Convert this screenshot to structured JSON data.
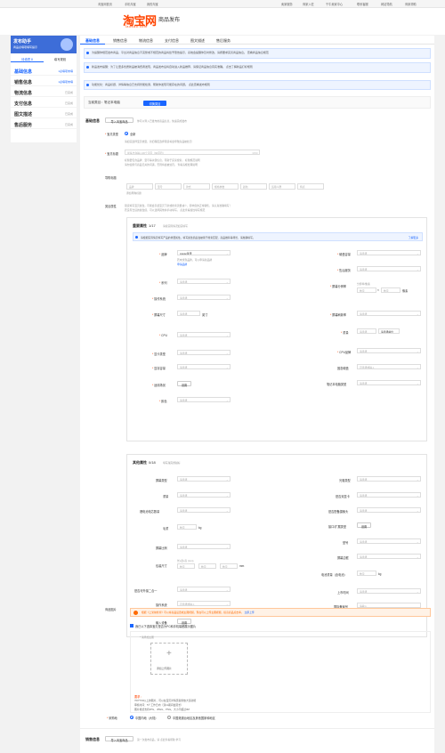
{
  "topbar": {
    "left": [
      "淘宝网首页",
      "手机淘宝",
      "我的淘宝"
    ],
    "right": [
      "卖家服务",
      "商家入驻",
      "千牛卖家中心",
      "联系客服",
      "网站导航",
      "商家帮助"
    ]
  },
  "header": {
    "logo": "淘宝网",
    "logo_sub": "Taobao.com",
    "title": "商品发布"
  },
  "sidebar": {
    "hero_title": "发布助手",
    "hero_sub": "商品必填项填写提示",
    "tabs": [
      "待填项 8",
      "填写规则"
    ],
    "items": [
      {
        "label": "基础信息",
        "status": "1必填项未填"
      },
      {
        "label": "销售信息",
        "status": "1必填项未填"
      },
      {
        "label": "物流信息",
        "status": "已完成"
      },
      {
        "label": "支付信息",
        "status": "已完成"
      },
      {
        "label": "图文描述",
        "status": "已完成"
      },
      {
        "label": "售后服务",
        "status": "已完成"
      }
    ]
  },
  "tabs": [
    "基础信息",
    "销售信息",
    "物流信息",
    "支付信息",
    "图文描述",
    "售后服务"
  ],
  "notices": [
    "为提醒你规范发布商品，平台对商品信息不完整或不规范的商品将给予警告提示，系统会提醒你及时修改，请按要求完善商品信息。 查看商品信息规范",
    "新品发布提醒：为了让更多优质新品被消费者发现，商品发布后将自动进入新品推荐，请保证商品信息真实准确。 点击了解新品打标规则",
    "功能优化：商品标题、详情等信息已支持智能检测，帮助你发现可能存在的问题。 点此查看发布规则"
  ],
  "category": {
    "label": "当前类目：笔记本电脑",
    "button": "切换类目"
  },
  "basic": {
    "section": "基础信息",
    "import_btn": "导入淘宝商品",
    "import_hint": "你可以导入已发布的商品信息，快速完成发布",
    "type_label": "宝贝类型",
    "type_value": "全新",
    "type_hint": "请如实选择宝贝类型，新旧程度选择错误将会导致商品被处罚",
    "title_label": "宝贝标题",
    "title_placeholder": "最多允许输入30个汉字（60字符）",
    "title_count": "0/60",
    "title_hint1": "标题要包含品牌、型号等关键信息，有助于买家搜索。 标题规范说明",
    "title_hint2": "请勿使用与商品无关的词语，否则将会被处罚。 查看违规处理说明",
    "guide_label": "导购标题",
    "guide_cells": [
      "品牌",
      "型号",
      "款式",
      "规格参数",
      "颜色",
      "适用人群",
      "特点"
    ],
    "guide_hint": "添加导购标题",
    "attr_label": "类目属性",
    "attr_hint1": "错误填写宝贝属性，可能会引起宝贝下架或搜索流量减少，影响您的正常销售，请认真准确填写！",
    "attr_hint2": "若没有合适的属性值，可以选择其他并手动填写。 点此查看属性填写规范"
  },
  "important": {
    "title": "重要属性",
    "count": "1/17",
    "sub": "请按实际情况如实填写",
    "tip": "请根据实际情况填写产品的重要属性，填写属性值后会被用于搜索匹配、商品推荐等场景，请准确填写。",
    "tip_link": "了解更多",
    "left": [
      {
        "label": "品牌",
        "value": "Apple/苹果"
      },
      {
        "label": "系列",
        "value": "请选择"
      },
      {
        "label": "操作系统",
        "value": "请选择"
      },
      {
        "label": "屏幕尺寸",
        "value": "请选择"
      },
      {
        "label": "CPU",
        "value": "请选择"
      },
      {
        "label": "显卡类型",
        "value": "请选择"
      },
      {
        "label": "显存容量",
        "value": "请选择"
      },
      {
        "label": "适用场景",
        "value": "设置"
      },
      {
        "label": "颜色",
        "value": "请选择"
      }
    ],
    "right": [
      {
        "label": "硬盘容量",
        "value": "请选择"
      },
      {
        "label": "售后服务",
        "value": "请选择"
      },
      {
        "label": "屏幕分辨率",
        "value": "请选择"
      },
      {
        "label": "屏幕刷新率",
        "value": "请选择"
      },
      {
        "label": "重量",
        "value": "请选择"
      },
      {
        "label": "CPU品牌",
        "value": "请选择"
      },
      {
        "label": "固态硬盘",
        "value": "可选择或输入"
      },
      {
        "label": "笔记本电脑类型",
        "value": "请选择"
      }
    ],
    "brand_hint": "若未找到品牌，可以申请新品牌",
    "brand_link": "申请品牌",
    "size_unit": "英寸",
    "res_hint": "分辨率/像素",
    "res_ph": [
      "数字",
      "数字"
    ],
    "res_unit": "像素",
    "weight_unit": "kg",
    "weight_ph": "请选择单位"
  },
  "other": {
    "title": "其他属性",
    "count": "0/18",
    "sub": "填写越完整越好",
    "left": [
      {
        "label": "屏幕类型",
        "value": "请选择"
      },
      {
        "label": "重量",
        "value": "请选择"
      },
      {
        "label": "锂电池电芯数量",
        "value": "请选择"
      },
      {
        "label": "毛重",
        "value": "数字"
      },
      {
        "label": "屏幕比例",
        "value": "请选择"
      },
      {
        "label": "包装尺寸",
        "value": "数字"
      },
      {
        "label": "是否可外接二合一",
        "value": "请选择"
      },
      {
        "label": "操作系统",
        "value": "可选择或输入"
      },
      {
        "label": "输入设备",
        "value": "设置"
      }
    ],
    "right": [
      {
        "label": "光驱类型",
        "value": "请选择"
      },
      {
        "label": "是否双显卡",
        "value": "请选择"
      },
      {
        "label": "是否配备摄像头",
        "value": "请选择"
      },
      {
        "label": "接口/扩展类型",
        "value": "设置"
      },
      {
        "label": "型号",
        "value": "请选择"
      },
      {
        "label": "屏幕边框",
        "value": "请选择"
      },
      {
        "label": "电池重量（含电池）",
        "value": "数字"
      },
      {
        "label": "上市时间",
        "value": "请选择"
      },
      {
        "label": "国际备案号",
        "value": "请输入"
      }
    ],
    "weight_unit": "kg",
    "size_unit": "mm",
    "size_hint": "长x宽x高 (mm)"
  },
  "media": {
    "label": "商品图片",
    "warn": "根据《上架前检查》可以将商品设置成主图视频，现在可以上传主图视频，提高商品点击率。",
    "warn_link": "立即上传",
    "chk_label": "我已以下选择宝贝是否为PC和手机端都展示图片",
    "upload_hint": "* 请添加主图",
    "upload_text": "添加上传图片",
    "notes_title": "要求：",
    "notes": [
      "700*700以上的图片，可以在宝贝详情页提供放大镜功能",
      "审核时间：5个工作日内（双11期间会延长）",
      "图片格式支持JPG、JPEG、PNG，大小不超过3M"
    ]
  },
  "origin": {
    "label": "采购地",
    "options": [
      "中国内地（大陆）",
      "中国港澳台地区及其他国家和地区"
    ]
  },
  "sales": {
    "section": "销售信息",
    "import_btn": "导入淘宝商品",
    "import_hint": "第一次发布商品，请 点此查看帮助 学习"
  }
}
